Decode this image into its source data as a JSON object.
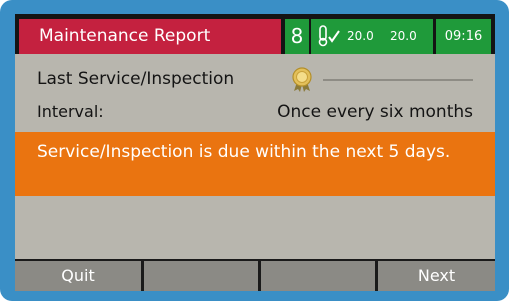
{
  "header": {
    "title": "Maintenance Report",
    "user_icon": "user-level-icon",
    "user_level": "8",
    "thermometer_icon": "thermometer-check-icon",
    "temp_1": "20.0",
    "temp_2": "20.0",
    "time": "09:16",
    "title_color": "#c4213f",
    "status_color": "#1f9a3a"
  },
  "content": {
    "last_service_label": "Last Service/Inspection",
    "badge_icon": "award-badge-icon",
    "interval_label": "Interval:",
    "interval_value": "Once every six months"
  },
  "alert": {
    "message": "Service/Inspection is due within the next 5 days.",
    "color": "#ea7410"
  },
  "softkeys": {
    "key1": "Quit",
    "key2": "",
    "key3": "",
    "key4": "Next"
  }
}
